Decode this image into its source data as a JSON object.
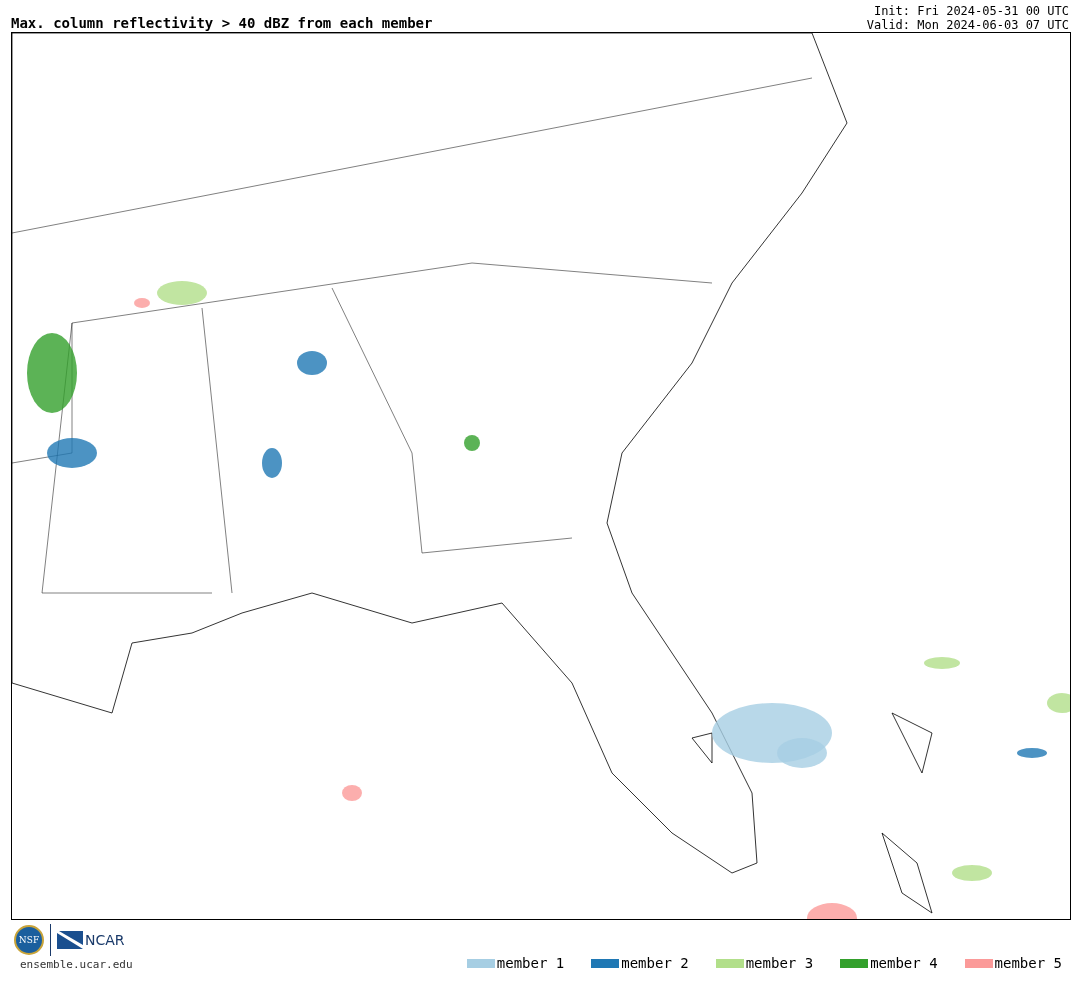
{
  "title": "Max. column reflectivity > 40 dBZ from each member",
  "init": "Init: Fri 2024-05-31 00 UTC",
  "valid": "Valid: Mon 2024-06-03 07 UTC",
  "logos": {
    "nsf": "NSF",
    "ncar": "NCAR",
    "url": "ensemble.ucar.edu"
  },
  "legend": [
    {
      "label": "member 1",
      "color": "#a6cee3"
    },
    {
      "label": "member 2",
      "color": "#1f78b4"
    },
    {
      "label": "member 3",
      "color": "#b2df8a"
    },
    {
      "label": "member 4",
      "color": "#33a02c"
    },
    {
      "label": "member 5",
      "color": "#fb9a99"
    }
  ]
}
